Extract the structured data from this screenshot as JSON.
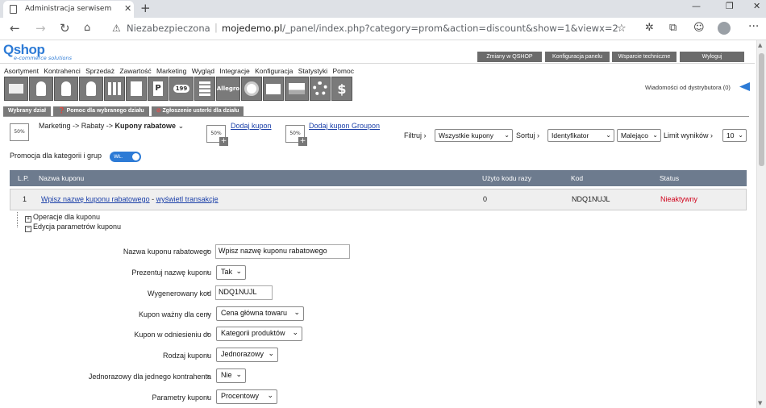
{
  "browser": {
    "tab_title": "Administracja serwisem",
    "security_label": "Niezabezpieczona",
    "url_domain": "mojedemo.pl",
    "url_path": "/_panel/index.php?category=prom&action=discount&show=1&viewx=2"
  },
  "header": {
    "logo": "Qshop",
    "tagline": "e-commerce solutions",
    "buttons": [
      "Zmiany w QSHOP",
      "Konfiguracja panelu",
      "Wsparcie techniczne",
      "Wyloguj"
    ]
  },
  "menu": [
    "Asortyment",
    "Kontrahenci",
    "Sprzedaż",
    "Zawartość",
    "Marketing",
    "Wygląd",
    "Integracje",
    "Konfiguracja",
    "Statystyki",
    "Pomoc"
  ],
  "icon_strip": {
    "badge_text": "199",
    "allegro_text": "Allegro"
  },
  "messages": "Wiadomości od dystrybutora (0)",
  "subtabs": [
    "Wybrany dział",
    "Pomoc dla wybranego działu",
    "Zgłoszenie usterki dla działu"
  ],
  "toolbar": {
    "pct": "50%",
    "breadcrumb_path": "Marketing -> Rabaty -> ",
    "breadcrumb_current": "Kupony rabatowe",
    "add_coupon": "Dodaj kupon",
    "add_groupon": "Dodaj kupon Groupon",
    "filter_label": "Filtruj",
    "filter_value": "Wszystkie kupony",
    "sort_label": "Sortuj",
    "sort_value": "Identyfikator",
    "order_value": "Malejąco",
    "limit_label": "Limit wyników",
    "limit_value": "10"
  },
  "promo": {
    "label": "Promocja dla kategorii i grup",
    "toggle_text": "WŁ."
  },
  "table": {
    "headers": [
      "L.P.",
      "Nazwa kuponu",
      "Użyto kodu razy",
      "Kod",
      "Status"
    ],
    "row": {
      "lp": "1",
      "name": "Wpisz nazwę kuponu rabatowego",
      "separator": " - ",
      "transactions": "wyświetl transakcje",
      "used": "0",
      "code": "NDQ1NUJL",
      "status": "Nieaktywny",
      "status_color": "#d0021b"
    }
  },
  "tree": {
    "ops": "Operacje dla kuponu",
    "edit": "Edycja parametrów kuponu"
  },
  "form": {
    "fields": [
      {
        "label": "Nazwa kuponu rabatowego",
        "value": "Wpisz nazwę kuponu rabatowego"
      },
      {
        "label": "Prezentuj nazwę kuponu",
        "value": "Tak"
      },
      {
        "label": "Wygenerowany kod",
        "value": "NDQ1NUJL"
      },
      {
        "label": "Kupon ważny dla ceny",
        "value": "Cena główna towaru"
      },
      {
        "label": "Kupon w odniesieniu do",
        "value": "Kategorii produktów"
      },
      {
        "label": "Rodzaj kuponu",
        "value": "Jednorazowy"
      },
      {
        "label": "Jednorazowy dla jednego kontrahenta",
        "value": "Nie"
      },
      {
        "label": "Parametry kuponu",
        "value": "Procentowy"
      }
    ]
  },
  "colors": {
    "accent": "#2d7bd6",
    "table_header": "#6d7b8e",
    "nav_gray": "#7a7a7a"
  }
}
